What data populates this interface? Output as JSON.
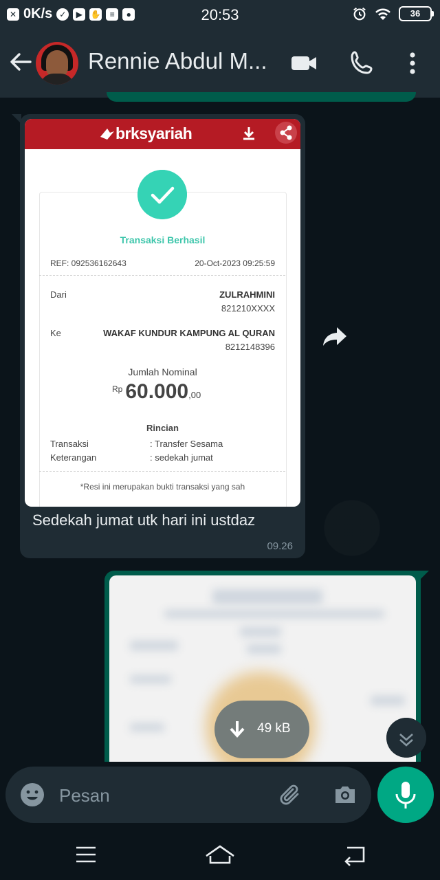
{
  "status_bar": {
    "speed": "0K/s",
    "time": "20:53",
    "battery": "36"
  },
  "header": {
    "contact_name": "Rennie Abdul M...",
    "icons": [
      "back-arrow-icon",
      "video-call-icon",
      "phone-icon",
      "more-vert-icon"
    ]
  },
  "incoming_message": {
    "receipt": {
      "brand": "brksyariah",
      "status": "Transaksi Berhasil",
      "ref": "REF: 092536162643",
      "datetime": "20-Oct-2023 09:25:59",
      "from_label": "Dari",
      "from_name": "ZULRAHMINI",
      "from_account": "821210XXXX",
      "to_label": "Ke",
      "to_name": "WAKAF KUNDUR KAMPUNG AL QURAN",
      "to_account": "8212148396",
      "amount_label": "Jumlah Nominal",
      "currency": "Rp",
      "amount": "60.000",
      "amount_decimal": ",00",
      "details_title": "Rincian",
      "transaction_label": "Transaksi",
      "transaction_value": ": Transfer Sesama",
      "note_label": "Keterangan",
      "note_value": ": sedekah jumat",
      "footer": "*Resi ini merupakan bukti transaksi yang sah"
    },
    "caption": "Sedekah jumat utk hari ini ustdaz",
    "time": "09.26"
  },
  "outgoing_message": {
    "download_size": "49 kB"
  },
  "composer": {
    "placeholder": "Pesan"
  },
  "colors": {
    "header_bg": "#1f2c34",
    "chat_bg": "#0b141a",
    "outgoing_bubble": "#005c4b",
    "accent": "#00a884",
    "receipt_red": "#b51b24",
    "success_teal": "#35d3b5"
  }
}
